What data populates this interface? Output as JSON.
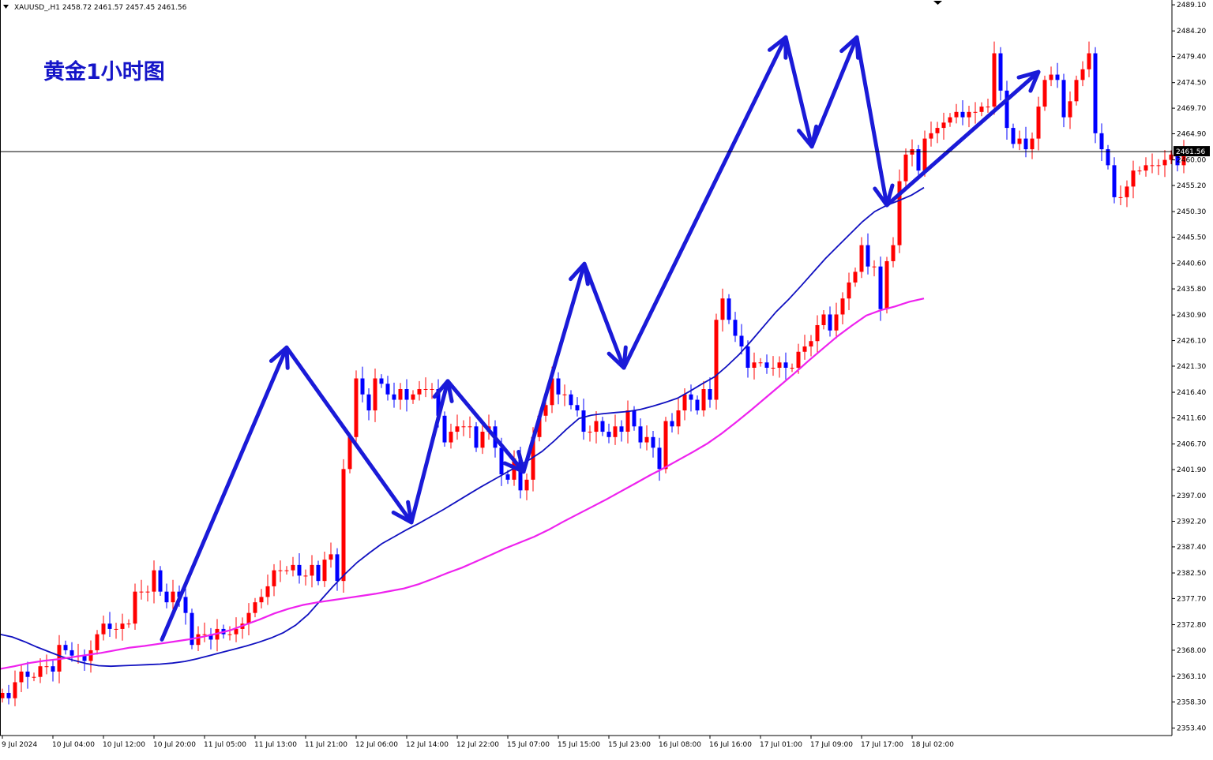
{
  "header": {
    "symbol_label": "XAUUSD_,H1 2458.72 2461.57 2457.45 2461.56"
  },
  "annotation": {
    "text": "黄金1小时图"
  },
  "current_price": {
    "label": "2461.56",
    "value": 2461.56
  },
  "colors": {
    "bull": "#ff0000",
    "bear": "#0000ff",
    "ma_fast": "#1010c0",
    "ma_slow": "#ee22ee",
    "arrow": "#1a1ad8",
    "grid_axis": "#000000",
    "price_tag_bg": "#000000"
  },
  "chart_data": {
    "type": "candlestick",
    "symbol": "XAUUSD_",
    "timeframe": "H1",
    "ohlc_last": {
      "open": 2458.72,
      "high": 2461.57,
      "low": 2457.45,
      "close": 2461.56
    },
    "ylim": [
      2352.0,
      2490.0
    ],
    "y_ticks": [
      "2489.10",
      "2484.20",
      "2479.40",
      "2474.50",
      "2469.70",
      "2464.90",
      "2460.00",
      "2455.20",
      "2450.30",
      "2445.50",
      "2440.60",
      "2435.80",
      "2430.90",
      "2426.10",
      "2421.30",
      "2416.40",
      "2411.60",
      "2406.70",
      "2401.90",
      "2397.00",
      "2392.20",
      "2387.40",
      "2382.50",
      "2377.70",
      "2372.80",
      "2368.00",
      "2363.10",
      "2358.30",
      "2353.40"
    ],
    "x_ticks": [
      "9 Jul 2024",
      "10 Jul 04:00",
      "10 Jul 12:00",
      "10 Jul 20:00",
      "11 Jul 05:00",
      "11 Jul 13:00",
      "11 Jul 21:00",
      "12 Jul 06:00",
      "12 Jul 14:00",
      "12 Jul 22:00",
      "15 Jul 07:00",
      "15 Jul 15:00",
      "15 Jul 23:00",
      "16 Jul 08:00",
      "16 Jul 16:00",
      "17 Jul 01:00",
      "17 Jul 09:00",
      "17 Jul 17:00",
      "18 Jul 02:00"
    ],
    "bars_per_tick": 8,
    "candles_close": [
      2360,
      2359,
      2362,
      2364,
      2363,
      2363,
      2365,
      2365,
      2364,
      2369,
      2368,
      2367,
      2367,
      2366,
      2368,
      2371,
      2373,
      2372,
      2372,
      2373,
      2373,
      2379,
      2379,
      2379,
      2383,
      2379,
      2377,
      2379,
      2378,
      2375,
      2369,
      2371,
      2371,
      2370,
      2372,
      2371,
      2371,
      2372,
      2373,
      2375,
      2377,
      2378,
      2380,
      2383,
      2383,
      2383,
      2384,
      2382,
      2382,
      2384,
      2381,
      2385,
      2386,
      2381,
      2402,
      2408,
      2419,
      2416,
      2413,
      2419,
      2418,
      2416,
      2415,
      2417,
      2415,
      2416,
      2417,
      2417,
      2417,
      2412,
      2407,
      2409,
      2410,
      2410,
      2410,
      2406,
      2409,
      2410,
      2406,
      2401,
      2400,
      2404,
      2398,
      2400,
      2408,
      2412,
      2414,
      2419,
      2416,
      2416,
      2414,
      2413,
      2409,
      2409,
      2411,
      2409,
      2408,
      2410,
      2409,
      2413,
      2410,
      2407,
      2408,
      2406,
      2402,
      2411,
      2410,
      2413,
      2416,
      2415,
      2413,
      2417,
      2415,
      2430,
      2434,
      2430,
      2427,
      2425,
      2421,
      2422,
      2422,
      2421,
      2421,
      2422,
      2421,
      2421,
      2424,
      2425,
      2426,
      2429,
      2431,
      2428,
      2431,
      2434,
      2437,
      2439,
      2444,
      2440,
      2440,
      2432,
      2441,
      2444,
      2456,
      2461,
      2462,
      2458,
      2464,
      2465,
      2466,
      2467,
      2468,
      2469,
      2468,
      2469,
      2469,
      2470,
      2470,
      2480,
      2473,
      2466,
      2463,
      2464,
      2462,
      2464,
      2470,
      2475,
      2476,
      2475,
      2468,
      2471,
      2475,
      2477,
      2480,
      2465,
      2462,
      2459,
      2453,
      2453,
      2455,
      2458,
      2458,
      2459,
      2459,
      2459,
      2460,
      2461,
      2459,
      2461.56
    ],
    "series": [
      {
        "name": "MA fast",
        "y": [
          2371,
          2370.5,
          2369.6,
          2368.6,
          2367.7,
          2366.8,
          2366.1,
          2365.5,
          2365.1,
          2365.0,
          2365.1,
          2365.2,
          2365.3,
          2365.4,
          2365.6,
          2365.9,
          2366.4,
          2367.0,
          2367.6,
          2368.2,
          2368.8,
          2369.5,
          2370.3,
          2371.3,
          2372.7,
          2374.7,
          2377.3,
          2379.9,
          2382.3,
          2384.5,
          2386.3,
          2388.0,
          2389.3,
          2390.6,
          2391.8,
          2393.1,
          2394.4,
          2395.8,
          2397.2,
          2398.6,
          2399.9,
          2401.2,
          2402.5,
          2403.8,
          2405.3,
          2407.3,
          2409.5,
          2411.5,
          2412.1,
          2412.4,
          2412.6,
          2412.8,
          2413.2,
          2413.8,
          2414.5,
          2415.3,
          2416.6,
          2418.0,
          2419.3,
          2421.3,
          2423.5,
          2426.1,
          2428.8,
          2431.5,
          2433.8,
          2436.3,
          2438.9,
          2441.5,
          2443.8,
          2446.1,
          2448.4,
          2450.3,
          2451.5,
          2452.4,
          2453.4,
          2454.8
        ]
      },
      {
        "name": "MA slow",
        "y": [
          2364.5,
          2365.0,
          2365.6,
          2366.0,
          2366.3,
          2366.7,
          2367.1,
          2367.5,
          2368.0,
          2368.5,
          2368.8,
          2369.2,
          2369.6,
          2370.0,
          2370.5,
          2371.1,
          2371.8,
          2372.8,
          2373.8,
          2374.9,
          2375.8,
          2376.5,
          2377.0,
          2377.4,
          2377.8,
          2378.2,
          2378.6,
          2379.1,
          2379.6,
          2380.4,
          2381.4,
          2382.5,
          2383.5,
          2384.7,
          2385.9,
          2387.1,
          2388.2,
          2389.3,
          2390.6,
          2392.1,
          2393.5,
          2394.9,
          2396.3,
          2397.8,
          2399.3,
          2400.8,
          2402.2,
          2403.7,
          2405.2,
          2406.8,
          2408.7,
          2410.8,
          2413.0,
          2415.3,
          2417.6,
          2419.9,
          2422.3,
          2424.6,
          2426.9,
          2428.9,
          2430.8,
          2431.8,
          2432.5,
          2433.4,
          2434.0
        ]
      }
    ],
    "arrows": [
      [
        2370.0,
        2424.8,
        2392.0,
        2418.5,
        2401.5,
        2440.5,
        2421.0,
        2483.0,
        2462.5,
        2483.0,
        2451.5,
        2476.5
      ]
    ]
  }
}
